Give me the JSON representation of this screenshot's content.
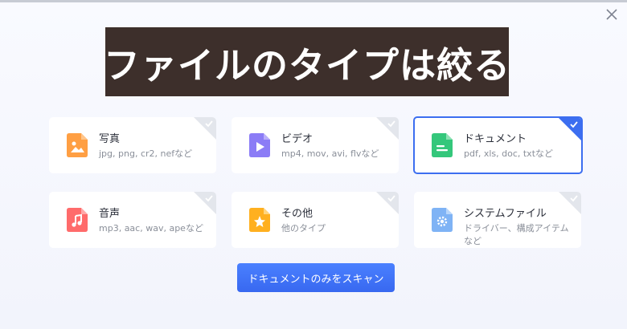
{
  "title": "ファイルのタイプは絞る",
  "cards": [
    {
      "label": "写真",
      "desc": "jpg, png, cr2, nefなど",
      "icon": "image-file-icon",
      "color": "#ff9f43",
      "selected": false
    },
    {
      "label": "ビデオ",
      "desc": "mp4, mov, avi, flvなど",
      "icon": "video-file-icon",
      "color": "#8b7cf6",
      "selected": false
    },
    {
      "label": "ドキュメント",
      "desc": "pdf, xls, doc, txtなど",
      "icon": "document-file-icon",
      "color": "#34c77b",
      "selected": true
    },
    {
      "label": "音声",
      "desc": "mp3, aac, wav, apeなど",
      "icon": "music-file-icon",
      "color": "#ff6b6b",
      "selected": false
    },
    {
      "label": "その他",
      "desc": "他のタイプ",
      "icon": "star-file-icon",
      "color": "#ffb020",
      "selected": false
    },
    {
      "label": "システムファイル",
      "desc": "ドライバー、構成アイテムなど",
      "icon": "gear-file-icon",
      "color": "#7fb3f5",
      "selected": false
    }
  ],
  "scan_button": "ドキュメントのみをスキャン",
  "colors": {
    "accent": "#3c6ef0",
    "banner": "#3d2f2b"
  }
}
